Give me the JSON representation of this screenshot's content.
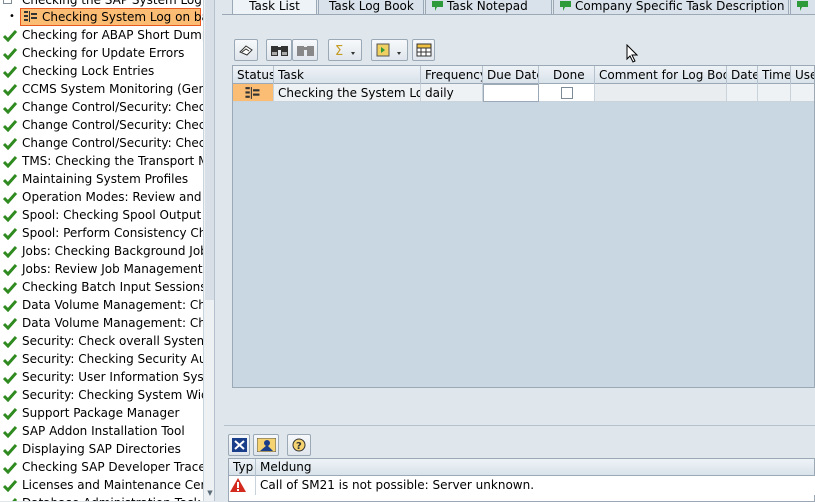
{
  "tree": {
    "parent_label": "Checking the SAP System Log",
    "selected_label": "Checking System Log on background",
    "items": [
      {
        "label": "Checking for ABAP Short Dumps"
      },
      {
        "label": "Checking for Update Errors"
      },
      {
        "label": "Checking Lock Entries"
      },
      {
        "label": "CCMS System Monitoring (General)"
      },
      {
        "label": "Change Control/Security: Check Client"
      },
      {
        "label": "Change Control/Security: Check Client"
      },
      {
        "label": "Change Control/Security: Check System"
      },
      {
        "label": "TMS: Checking the Transport Management"
      },
      {
        "label": "Maintaining System Profiles"
      },
      {
        "label": "Operation Modes: Review and adjust"
      },
      {
        "label": "Spool: Checking Spool Output Requests"
      },
      {
        "label": "Spool: Perform Consistency Check"
      },
      {
        "label": "Jobs: Checking Background Jobs"
      },
      {
        "label": "Jobs: Review Job Management Settings"
      },
      {
        "label": "Checking Batch Input Sessions"
      },
      {
        "label": "Data Volume Management: Check"
      },
      {
        "label": "Data Volume Management: Check"
      },
      {
        "label": "Security: Check overall System Security"
      },
      {
        "label": "Security: Checking Security Audit Log"
      },
      {
        "label": "Security: User Information System"
      },
      {
        "label": "Security: Checking System Wide"
      },
      {
        "label": "Support Package Manager"
      },
      {
        "label": "SAP Addon Installation Tool"
      },
      {
        "label": "Displaying SAP Directories"
      },
      {
        "label": "Checking SAP Developer Traces"
      },
      {
        "label": "Licenses and Maintenance Certificates"
      },
      {
        "label": "Database Administration Task Group"
      }
    ]
  },
  "tabs": [
    {
      "label": "Task List",
      "active": true
    },
    {
      "label": "Task Log Book",
      "active": false
    },
    {
      "label": "Task Notepad",
      "active": false
    },
    {
      "label": "Company Specific Task Description",
      "active": false
    },
    {
      "label": "",
      "active": false
    }
  ],
  "grid": {
    "headers": {
      "status": "Status",
      "task": "Task",
      "frequency": "Frequency",
      "due_date": "Due Date",
      "done": "Done",
      "comment": "Comment for Log Book",
      "date": "Date",
      "time": "Time",
      "user": "User"
    },
    "row": {
      "task": "Checking the System Log",
      "frequency": "daily",
      "due_date": "",
      "comment": "",
      "done_checked": false
    }
  },
  "messages": {
    "headers": {
      "type": "Typ",
      "text": "Meldung"
    },
    "rows": [
      {
        "type": "error",
        "text": "Call of SM21 is not possible: Server unknown."
      }
    ]
  },
  "colors": {
    "selection": "#fbbd74",
    "selection_border": "#e8581f",
    "check_green": "#2f8a1f",
    "error_red": "#d42a1e",
    "tab_flag_green": "#2e9a3a"
  }
}
